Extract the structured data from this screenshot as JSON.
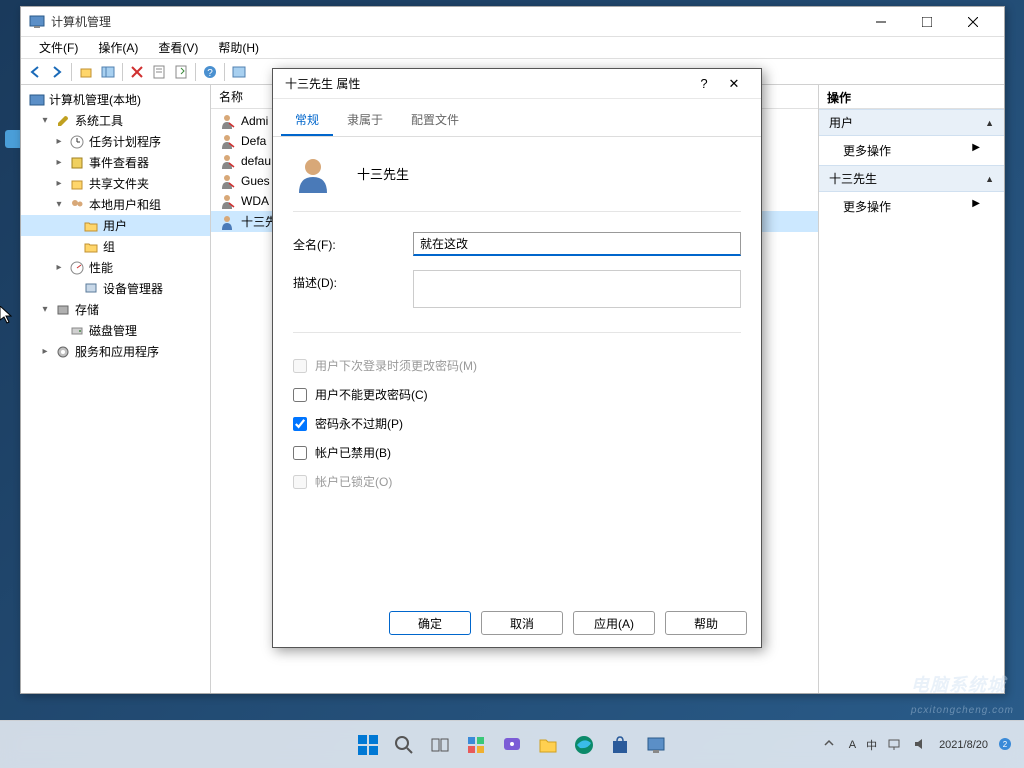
{
  "window": {
    "title": "计算机管理",
    "menus": [
      "文件(F)",
      "操作(A)",
      "查看(V)",
      "帮助(H)"
    ]
  },
  "tree": {
    "root": "计算机管理(本地)",
    "nodes": [
      {
        "indent": 1,
        "toggle": "▾",
        "label": "系统工具",
        "icon": "wrench"
      },
      {
        "indent": 2,
        "toggle": "▸",
        "label": "任务计划程序",
        "icon": "clock"
      },
      {
        "indent": 2,
        "toggle": "▸",
        "label": "事件查看器",
        "icon": "event"
      },
      {
        "indent": 2,
        "toggle": "▸",
        "label": "共享文件夹",
        "icon": "share"
      },
      {
        "indent": 2,
        "toggle": "▾",
        "label": "本地用户和组",
        "icon": "users"
      },
      {
        "indent": 3,
        "toggle": "",
        "label": "用户",
        "icon": "folder",
        "selected": true
      },
      {
        "indent": 3,
        "toggle": "",
        "label": "组",
        "icon": "folder"
      },
      {
        "indent": 2,
        "toggle": "▸",
        "label": "性能",
        "icon": "perf"
      },
      {
        "indent": 3,
        "toggle": "",
        "label": "设备管理器",
        "icon": "device"
      },
      {
        "indent": 1,
        "toggle": "▾",
        "label": "存储",
        "icon": "storage"
      },
      {
        "indent": 2,
        "toggle": "",
        "label": "磁盘管理",
        "icon": "disk"
      },
      {
        "indent": 1,
        "toggle": "▸",
        "label": "服务和应用程序",
        "icon": "services"
      }
    ]
  },
  "list": {
    "header": "名称",
    "items": [
      {
        "label": "Admi",
        "icon": "user"
      },
      {
        "label": "Defa",
        "icon": "user"
      },
      {
        "label": "defau",
        "icon": "user"
      },
      {
        "label": "Gues",
        "icon": "user"
      },
      {
        "label": "WDA",
        "icon": "user"
      },
      {
        "label": "十三先",
        "icon": "user-sel",
        "selected": true
      }
    ]
  },
  "actions": {
    "header": "操作",
    "sections": [
      {
        "title": "用户",
        "items": [
          "更多操作"
        ]
      },
      {
        "title": "十三先生",
        "items": [
          "更多操作"
        ]
      }
    ]
  },
  "dialog": {
    "title": "十三先生 属性",
    "tabs": [
      "常规",
      "隶属于",
      "配置文件"
    ],
    "userName": "十三先生",
    "fullNameLabel": "全名(F):",
    "fullNameValue": "就在这改",
    "descLabel": "描述(D):",
    "descValue": "",
    "checks": [
      {
        "label": "用户下次登录时须更改密码(M)",
        "checked": false,
        "disabled": true
      },
      {
        "label": "用户不能更改密码(C)",
        "checked": false,
        "disabled": false
      },
      {
        "label": "密码永不过期(P)",
        "checked": true,
        "disabled": false
      },
      {
        "label": "帐户已禁用(B)",
        "checked": false,
        "disabled": false
      },
      {
        "label": "帐户已锁定(O)",
        "checked": false,
        "disabled": true
      }
    ],
    "buttons": {
      "ok": "确定",
      "cancel": "取消",
      "apply": "应用(A)",
      "help": "帮助"
    }
  },
  "taskbar": {
    "time": "2021/8/20",
    "watermark": "电脑系统城",
    "subwatermark": "pcxitongcheng.com"
  }
}
